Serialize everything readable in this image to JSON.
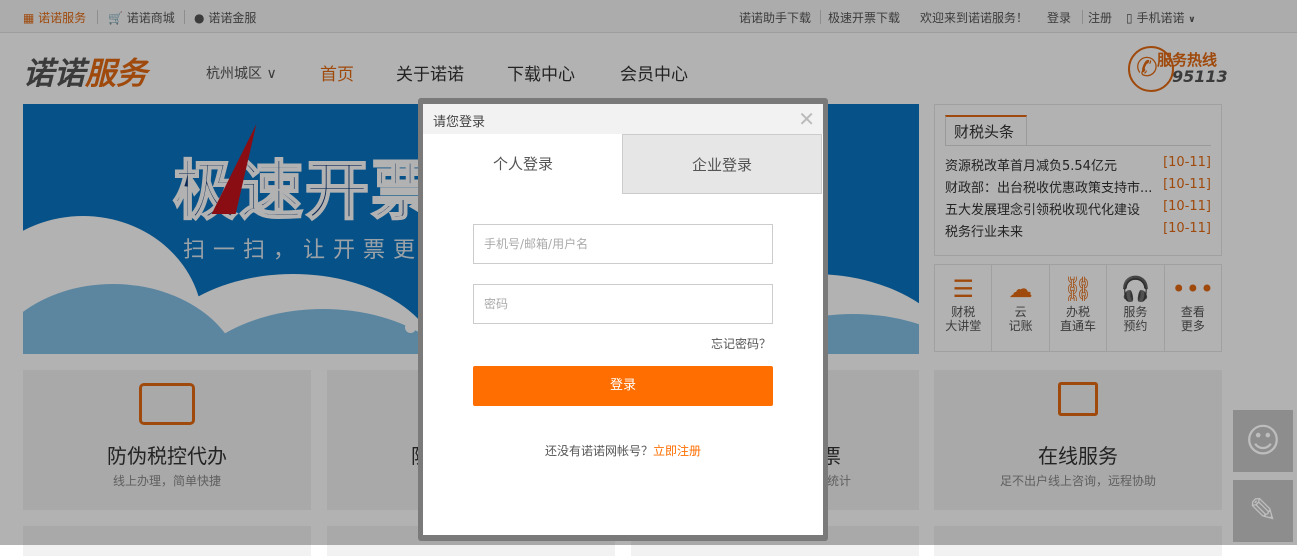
{
  "topbar": {
    "left": [
      {
        "label": "诺诺服务",
        "icon": "grid-icon"
      },
      {
        "label": "诺诺商城",
        "icon": "cart-icon"
      },
      {
        "label": "诺诺金服",
        "icon": "coin-icon"
      }
    ],
    "right": {
      "assistant": "诺诺助手下载",
      "fast_invoice": "极速开票下载",
      "welcome": "欢迎来到诺诺服务！",
      "login": "登录",
      "register": "注册",
      "mobile": "手机诺诺"
    }
  },
  "header": {
    "logo_a": "诺诺",
    "logo_b": "服务",
    "city": "杭州城区",
    "nav": [
      "首页",
      "关于诺诺",
      "下载中心",
      "会员中心"
    ],
    "hotline_label": "服务热线",
    "hotline_number": "95113"
  },
  "banner": {
    "title": "极速开票",
    "subtitle": "扫一扫，让开票更"
  },
  "news": {
    "tab": "财税头条",
    "items": [
      {
        "title": "资源税改革首月减负5.54亿元",
        "date": "[10-11]"
      },
      {
        "title": "财政部：出台税收优惠政策支持市...",
        "date": "[10-11]"
      },
      {
        "title": "五大发展理念引领税收现代化建设",
        "date": "[10-11]"
      },
      {
        "title": "税务行业未来",
        "date": "[10-11]"
      }
    ]
  },
  "services": [
    {
      "l1": "财税",
      "l2": "大讲堂",
      "icon": "books-icon"
    },
    {
      "l1": "云",
      "l2": "记账",
      "icon": "cloud-yen-icon"
    },
    {
      "l1": "办税",
      "l2": "直通车",
      "icon": "link-icon"
    },
    {
      "l1": "服务",
      "l2": "预约",
      "icon": "headset-icon"
    },
    {
      "l1": "查看",
      "l2": "更多",
      "icon": "more-icon"
    }
  ],
  "cards": [
    {
      "title": "防伪税控代办",
      "sub": "线上办理，简单快捷"
    },
    {
      "title": "防",
      "sub": ""
    },
    {
      "title": "票",
      "sub": "统计"
    },
    {
      "title": "在线服务",
      "sub": "足不出户线上咨询，远程协助"
    }
  ],
  "modal": {
    "title": "请您登录",
    "tabs": [
      "个人登录",
      "企业登录"
    ],
    "active_tab": 0,
    "username_placeholder": "手机号/邮箱/用户名",
    "password_placeholder": "密码",
    "forgot": "忘记密码？",
    "submit": "登录",
    "no_account": "还没有诺诺网帐号？",
    "register_now": "立即注册"
  },
  "colors": {
    "accent": "#ff6e00",
    "brand": "#e46a12"
  }
}
